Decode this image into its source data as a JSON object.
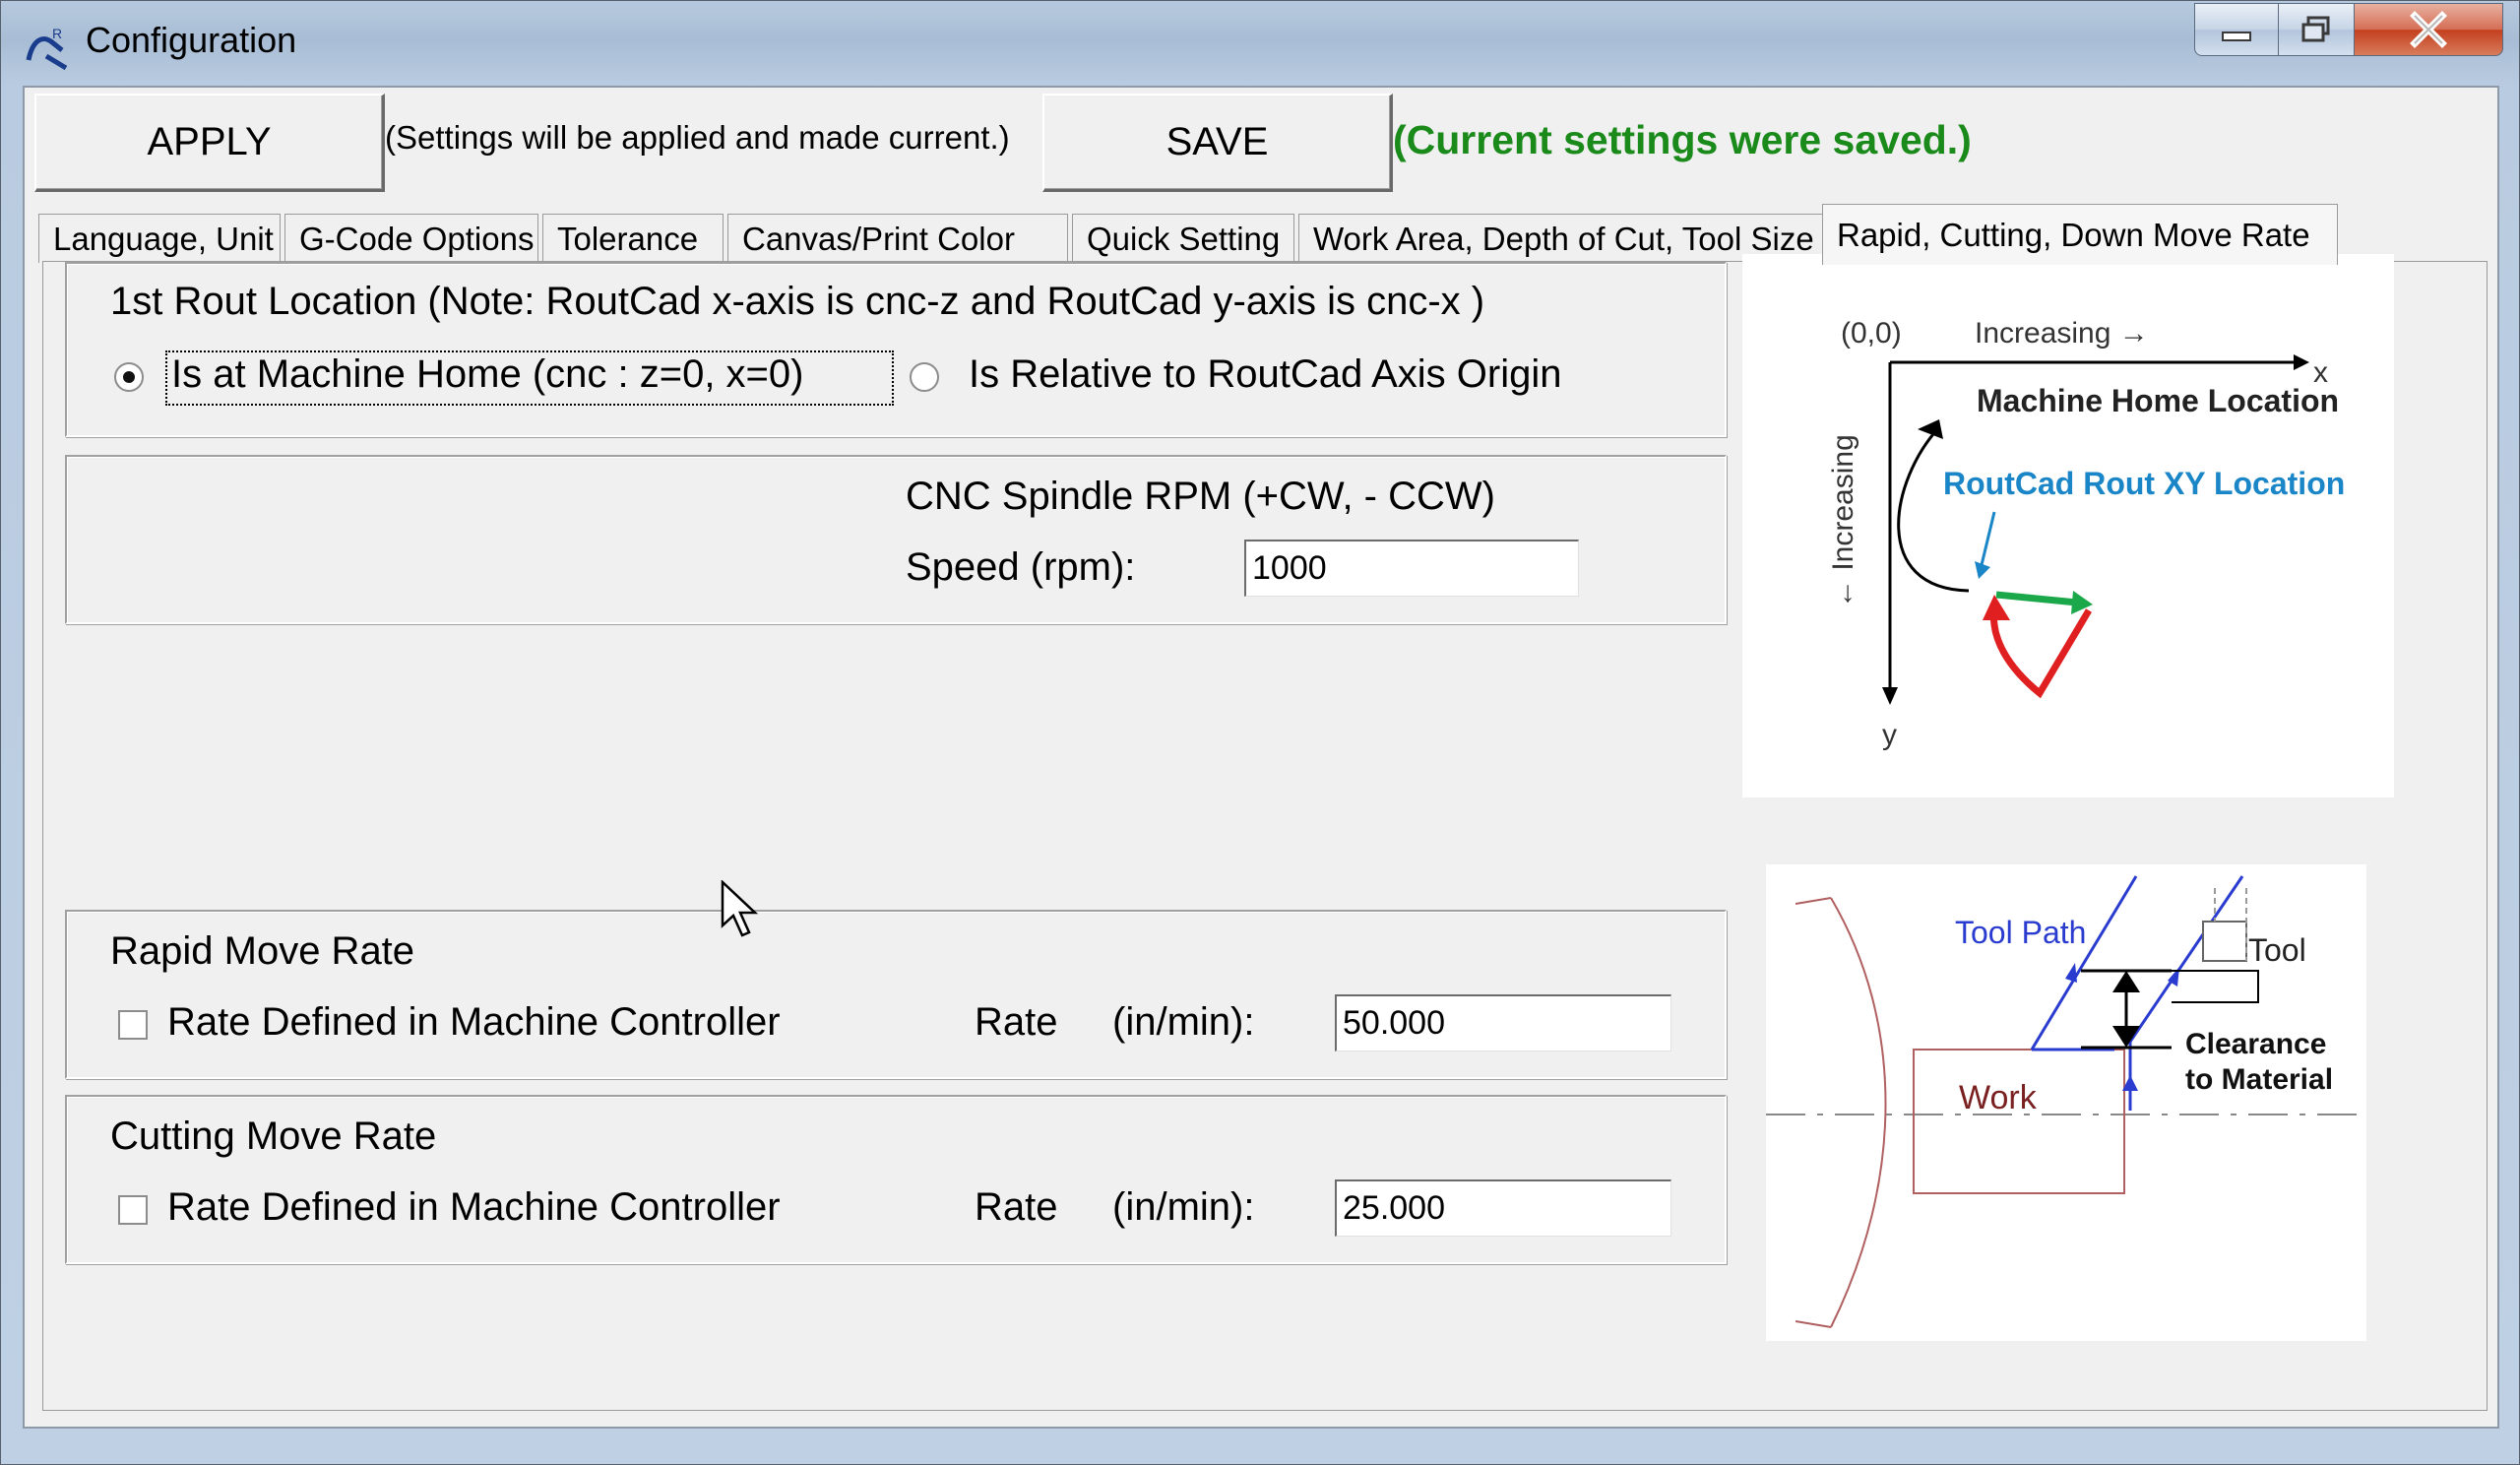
{
  "window": {
    "title": "Configuration"
  },
  "toolbar": {
    "apply_label": "APPLY",
    "apply_note": "(Settings will be applied and made current.)",
    "save_label": "SAVE",
    "save_note": "(Current settings were saved.)"
  },
  "tabs": [
    {
      "label": "Language, Unit"
    },
    {
      "label": "G-Code Options"
    },
    {
      "label": "Tolerance"
    },
    {
      "label": "Canvas/Print Color"
    },
    {
      "label": "Quick Setting"
    },
    {
      "label": "Work Area, Depth of Cut, Tool Size"
    },
    {
      "label": "Rapid, Cutting, Down Move Rate"
    }
  ],
  "rout_location": {
    "heading": "1st Rout Location (Note: RoutCad x-axis is cnc-z and RoutCad y-axis is cnc-x )",
    "option_home": "Is at Machine Home (cnc : z=0, x=0)",
    "option_relative": "Is Relative to RoutCad Axis Origin",
    "selected": "home"
  },
  "spindle": {
    "heading": "CNC Spindle RPM (+CW, - CCW)",
    "speed_label": "Speed  (rpm):",
    "speed_value": "1000"
  },
  "rapid": {
    "heading": "Rapid Move Rate",
    "checkbox_label": "Rate Defined in Machine Controller",
    "rate_label": "Rate",
    "unit_label": "(in/min):",
    "rate_value": "50.000"
  },
  "cutting": {
    "heading": "Cutting Move Rate",
    "checkbox_label": "Rate Defined in Machine Controller",
    "rate_label": "Rate",
    "unit_label": "(in/min):",
    "rate_value": "25.000"
  },
  "diagram_axes": {
    "origin": "(0,0)",
    "increasing_x": "Increasing →",
    "x_label": "x",
    "increasing_y": "← Increasing",
    "y_label": "y",
    "machine_home": "Machine Home Location",
    "rout_xy": "RoutCad Rout XY Location",
    "rout_xy_color": "#1a86c8",
    "path_green": "#1aa84a",
    "path_red": "#e02020"
  },
  "diagram_tool": {
    "tool_path": "Tool Path",
    "tool": "Tool",
    "clearance_line1": "Clearance",
    "clearance_line2": "to Material",
    "work": "Work",
    "path_color": "#2a3cd0",
    "work_color": "#7a2020"
  }
}
